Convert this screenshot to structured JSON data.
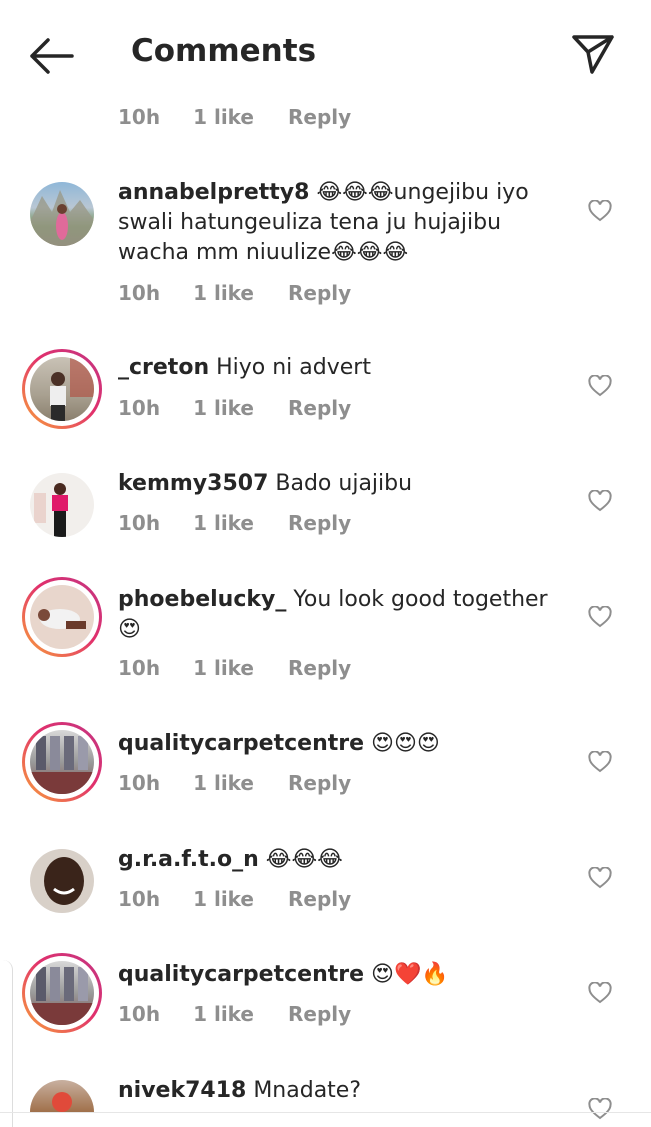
{
  "header": {
    "title": "Comments",
    "back_icon": "arrow-left-icon",
    "send_icon": "paper-plane-icon"
  },
  "top_meta": {
    "time": "10h",
    "likes": "1 like",
    "reply": "Reply"
  },
  "comments": [
    {
      "username": "annabelpretty8",
      "text": "😂😂😂ungejibu iyo swali hatungeuliza tena ju hujajibu wacha mm niuulize😂😂😂",
      "time": "10h",
      "likes": "1 like",
      "reply": "Reply",
      "story_ring": false
    },
    {
      "username": "_creton",
      "text": "Hiyo ni advert",
      "time": "10h",
      "likes": "1 like",
      "reply": "Reply",
      "story_ring": true
    },
    {
      "username": "kemmy3507",
      "text": "Bado ujajibu",
      "time": "10h",
      "likes": "1 like",
      "reply": "Reply",
      "story_ring": false
    },
    {
      "username": "phoebelucky_",
      "text": "You look good together 😍",
      "time": "10h",
      "likes": "1 like",
      "reply": "Reply",
      "story_ring": true
    },
    {
      "username": "qualitycarpetcentre",
      "text": "😍😍😍",
      "time": "10h",
      "likes": "1 like",
      "reply": "Reply",
      "story_ring": true
    },
    {
      "username": "g.r.a.f.t.o_n",
      "text": "😂😂😂",
      "time": "10h",
      "likes": "1 like",
      "reply": "Reply",
      "story_ring": false
    },
    {
      "username": "qualitycarpetcentre",
      "text": "😍❤️🔥",
      "time": "10h",
      "likes": "1 like",
      "reply": "Reply",
      "story_ring": true
    },
    {
      "username": "nivek7418",
      "text": "Mnadate?",
      "time": "",
      "likes": "",
      "reply": "",
      "story_ring": false
    }
  ],
  "colors": {
    "text": "#262626",
    "meta": "#8e8e8e",
    "ring_start": "#f9a33a",
    "ring_end": "#c13584"
  }
}
